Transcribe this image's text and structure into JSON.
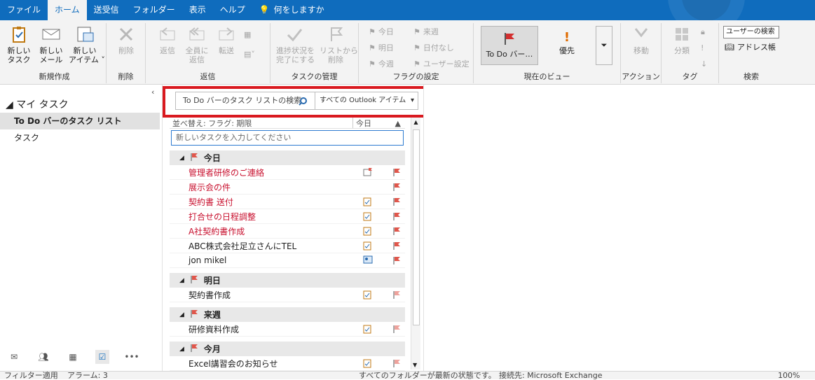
{
  "ribbon_tabs": [
    "ファイル",
    "ホーム",
    "送受信",
    "フォルダー",
    "表示",
    "ヘルプ",
    "何をしますか"
  ],
  "groups": {
    "new": {
      "title": "新規作成",
      "task": "新しい\nタスク",
      "mail": "新しい\nメール",
      "items": "新しい\nアイテム ˅"
    },
    "delete": {
      "title": "削除",
      "delete": "削除"
    },
    "respond": {
      "title": "返信",
      "reply": "返信",
      "reply_all": "全員に\n返信",
      "forward": "転送"
    },
    "manage": {
      "title": "タスクの管理",
      "mark_complete": "進捗状況を\n完了にする",
      "remove_from_list": "リストから\n削除"
    },
    "followup": {
      "title": "フラグの設定",
      "today": "今日",
      "next_week": "来週",
      "tomorrow": "明日",
      "no_date": "日付なし",
      "this_week": "今週",
      "custom": "ユーザー設定"
    },
    "current_view": {
      "title": "現在のビュー",
      "todo_bar": "To Do バー…",
      "priority": "優先"
    },
    "actions": {
      "title": "アクション",
      "move": "移動"
    },
    "tags": {
      "title": "タグ",
      "categorize": "分類"
    },
    "find": {
      "title": "検索",
      "search_people": "ユーザーの検索",
      "address_book": "アドレス帳"
    }
  },
  "nav": {
    "my_tasks": "マイ タスク",
    "items": [
      "To Do バーのタスク リスト",
      "タスク"
    ]
  },
  "search": {
    "placeholder": "To Do バーのタスク リストの検索",
    "scope": "すべての Outlook アイテム"
  },
  "sort": {
    "label": "並べ替え: フラグ: 期限",
    "right": "今日"
  },
  "new_task_placeholder": "新しいタスクを入力してください",
  "groups_list": [
    {
      "label": "今日",
      "rows": [
        {
          "title": "管理者研修のご連絡",
          "red": true,
          "icon": "meeting-icon"
        },
        {
          "title": "展示会の件",
          "red": true,
          "icon": ""
        },
        {
          "title": "契約書 送付",
          "red": true,
          "icon": "task-icon"
        },
        {
          "title": "打合せの日程調整",
          "red": true,
          "icon": "task-icon"
        },
        {
          "title": "A社契約書作成",
          "red": true,
          "icon": "task-icon"
        },
        {
          "title": "ABC株式会社足立さんにTEL",
          "red": false,
          "icon": "task-icon"
        },
        {
          "title": "jon mikel",
          "red": false,
          "icon": "contact-icon"
        }
      ]
    },
    {
      "label": "明日",
      "rows": [
        {
          "title": "契約書作成",
          "red": false,
          "icon": "task-icon"
        }
      ]
    },
    {
      "label": "来週",
      "rows": [
        {
          "title": "研修資料作成",
          "red": false,
          "icon": "task-icon"
        }
      ]
    },
    {
      "label": "今月",
      "rows": [
        {
          "title": "Excel講習会のお知らせ",
          "red": false,
          "icon": "task-icon"
        }
      ]
    }
  ],
  "status": {
    "filter": "フィルター適用",
    "alarm": "アラーム: 3",
    "folders": "すべてのフォルダーが最新の状態です。",
    "connected": "接続先: Microsoft Exchange",
    "zoom": "100%"
  },
  "colors": {
    "accent": "#0f6cbd",
    "flag": "#e0564b",
    "highlight": "#d9191f"
  }
}
